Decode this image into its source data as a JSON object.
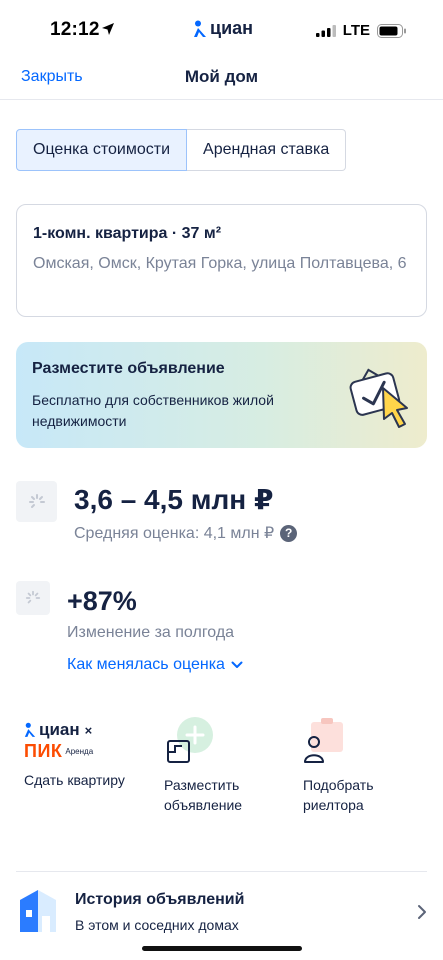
{
  "status_bar": {
    "time": "12:12",
    "brand": "циан",
    "network": "LTE",
    "icons": [
      "location-arrow-icon",
      "signal-icon",
      "battery-icon"
    ]
  },
  "nav": {
    "close_label": "Закрыть",
    "title": "Мой дом"
  },
  "tabs": [
    {
      "label": "Оценка стоимости",
      "active": true
    },
    {
      "label": "Арендная ставка",
      "active": false
    }
  ],
  "property": {
    "title": "1-комн. квартира · 37 м²",
    "address": "Омская, Омск, Крутая Горка, улица Полтавцева, 6"
  },
  "promo": {
    "title": "Разместите объявление",
    "description": "Бесплатно для собственников жилой недвижимости"
  },
  "estimate": {
    "range": "3,6 – 4,5 млн ₽",
    "average": "Средняя оценка: 4,1 млн ₽",
    "help_icon": "?"
  },
  "change": {
    "value": "+87%",
    "label": "Изменение за полгода",
    "link": "Как менялась оценка"
  },
  "actions": [
    {
      "label": "Сдать квартиру",
      "logo_top": "циан",
      "logo_bottom": "ПИК",
      "logo_badge": "Аренда",
      "logo_x": "×"
    },
    {
      "label": "Разместить объявление"
    },
    {
      "label": "Подобрать риелтора"
    }
  ],
  "history": {
    "title": "История объявлений",
    "subtitle": "В этом и соседних домах"
  },
  "colors": {
    "accent": "#0468ff",
    "text": "#152242",
    "muted": "#7a8397",
    "pik_orange": "#fc4c02"
  }
}
